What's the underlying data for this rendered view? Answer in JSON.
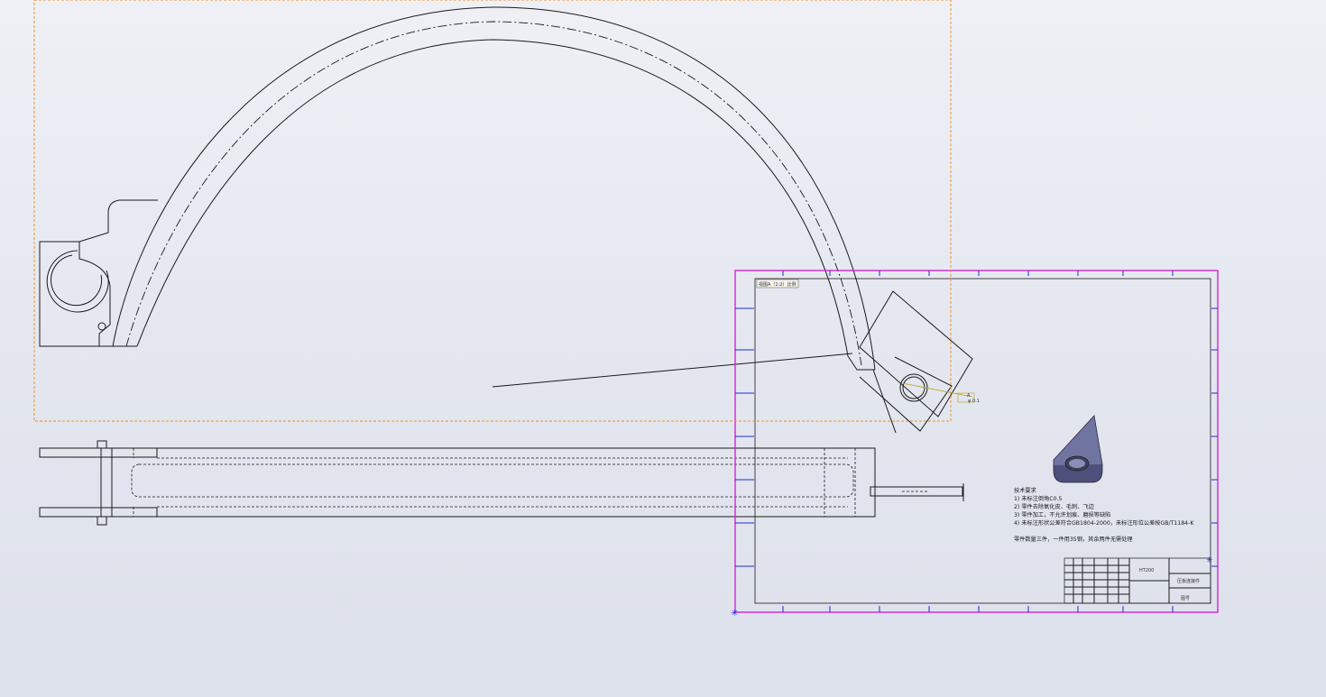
{
  "sheet": {
    "tab_label": "视图A（1:2）比例",
    "technical_notes": {
      "title": "技术要求",
      "items": [
        "1) 未标注倒角C0.5",
        "2) 零件去除氧化皮、毛刺、飞边",
        "3) 零件加工，不允许划痕、磨损等缺陷",
        "4) 未标注形状公差符合GB1804-2000，未标注形位公差按GB/T1184-K"
      ],
      "quantity_note": "零件数量三件，一件用35钢，其余两件无需处理"
    },
    "title_block": {
      "material": "HT200",
      "part_name": "压板连接件",
      "drawing_no": "图号"
    },
    "annotation": {
      "datum": "A",
      "tolerance": "φ 0.1"
    }
  },
  "colors": {
    "sheet_fill": "#e8e6da",
    "sheet_border": "#d822d8",
    "selection_box": "#f0922e",
    "model_fill": "#6f74a0",
    "line": "#1a1a1a"
  },
  "icons": [
    "origin-marker-icon",
    "tolerance-frame-icon"
  ]
}
